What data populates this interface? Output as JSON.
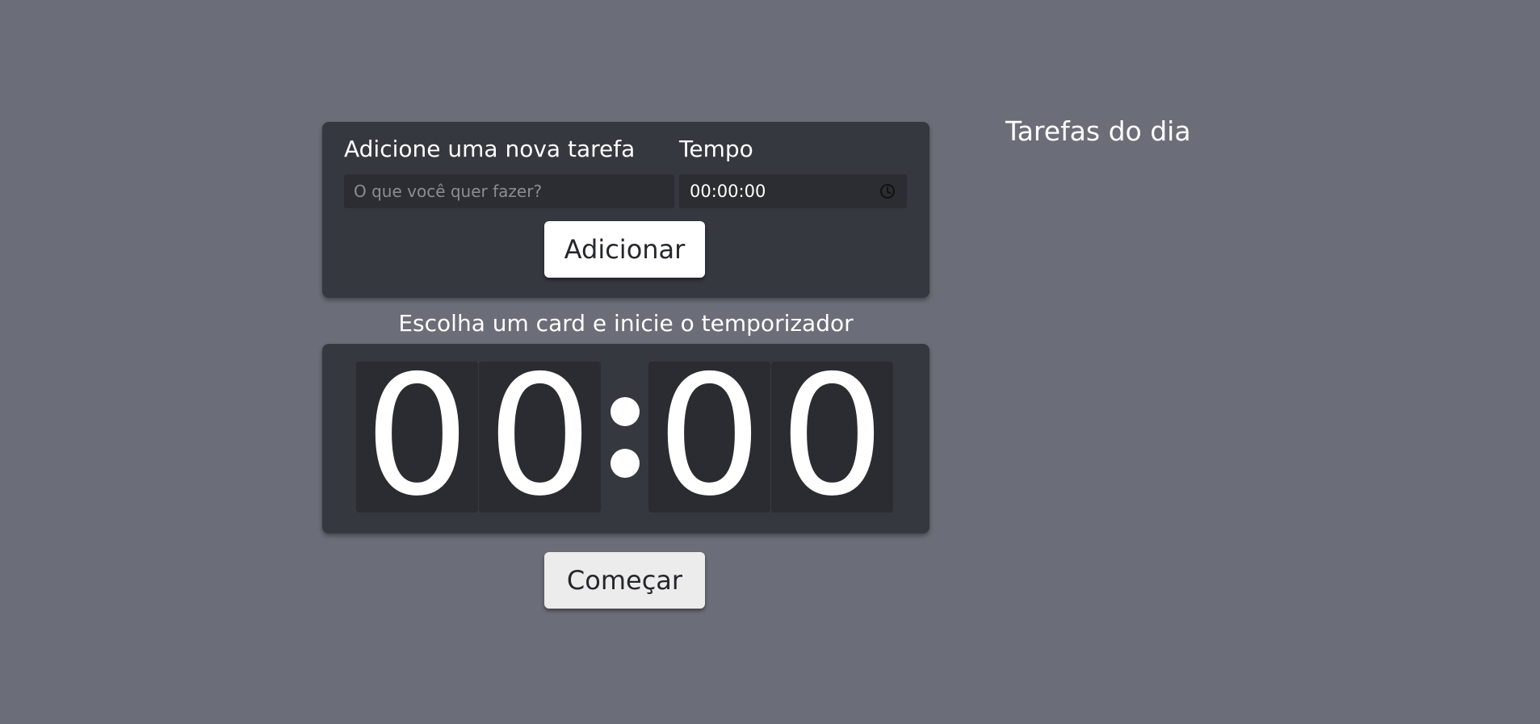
{
  "form": {
    "task_label": "Adicione uma nova tarefa",
    "time_label": "Tempo",
    "task_placeholder": "O que você quer fazer?",
    "task_value": "",
    "time_value": "00:00:00",
    "time_icon": "clock-icon",
    "add_button": "Adicionar"
  },
  "timer": {
    "subtitle": "Escolha um card e inicie o temporizador",
    "minutes_tens": "0",
    "minutes_ones": "0",
    "seconds_tens": "0",
    "seconds_ones": "0",
    "start_button": "Começar"
  },
  "tasks": {
    "title": "Tarefas do dia"
  }
}
